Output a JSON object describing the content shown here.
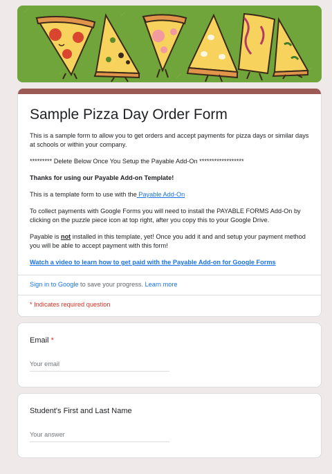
{
  "banner": {
    "alt": "pizza-slices-banner",
    "accent": "#9b5b54",
    "bg": "#6fa53a"
  },
  "form": {
    "title": "Sample Pizza Day Order Form",
    "desc1": "This is a sample form to allow you to get orders and accept payments for pizza days or similar days at schools or within your company.",
    "desc2": "********* Delete Below Once You Setup the Payable Add-On ******************",
    "desc3": "Thanks for using our Payable Add-on Template!",
    "desc4_pre": "This is a template form to use with the",
    "desc4_link": " Payable Add-On",
    "desc5": "To collect payments with Google Forms you will need to install the PAYABLE FORMS Add-On by clicking on the puzzle piece icon at top right, after you copy this to your Google Drive.",
    "desc6_pre": "Payable is ",
    "desc6_not": "not",
    "desc6_post": " installed in this template, yet! Once you add it and and setup your payment method you will be able to accept payment with this form!",
    "video_link": "Watch a video to learn how to get paid with the Payable Add-on for Google Forms"
  },
  "signin": {
    "link": "Sign in to Google",
    "text": " to save your progress. ",
    "learn_more": "Learn more"
  },
  "required_note": "* Indicates required question",
  "questions": [
    {
      "label": "Email",
      "required_mark": "*",
      "placeholder": "Your email"
    },
    {
      "label": "Student's First and Last Name",
      "placeholder": "Your answer"
    }
  ]
}
